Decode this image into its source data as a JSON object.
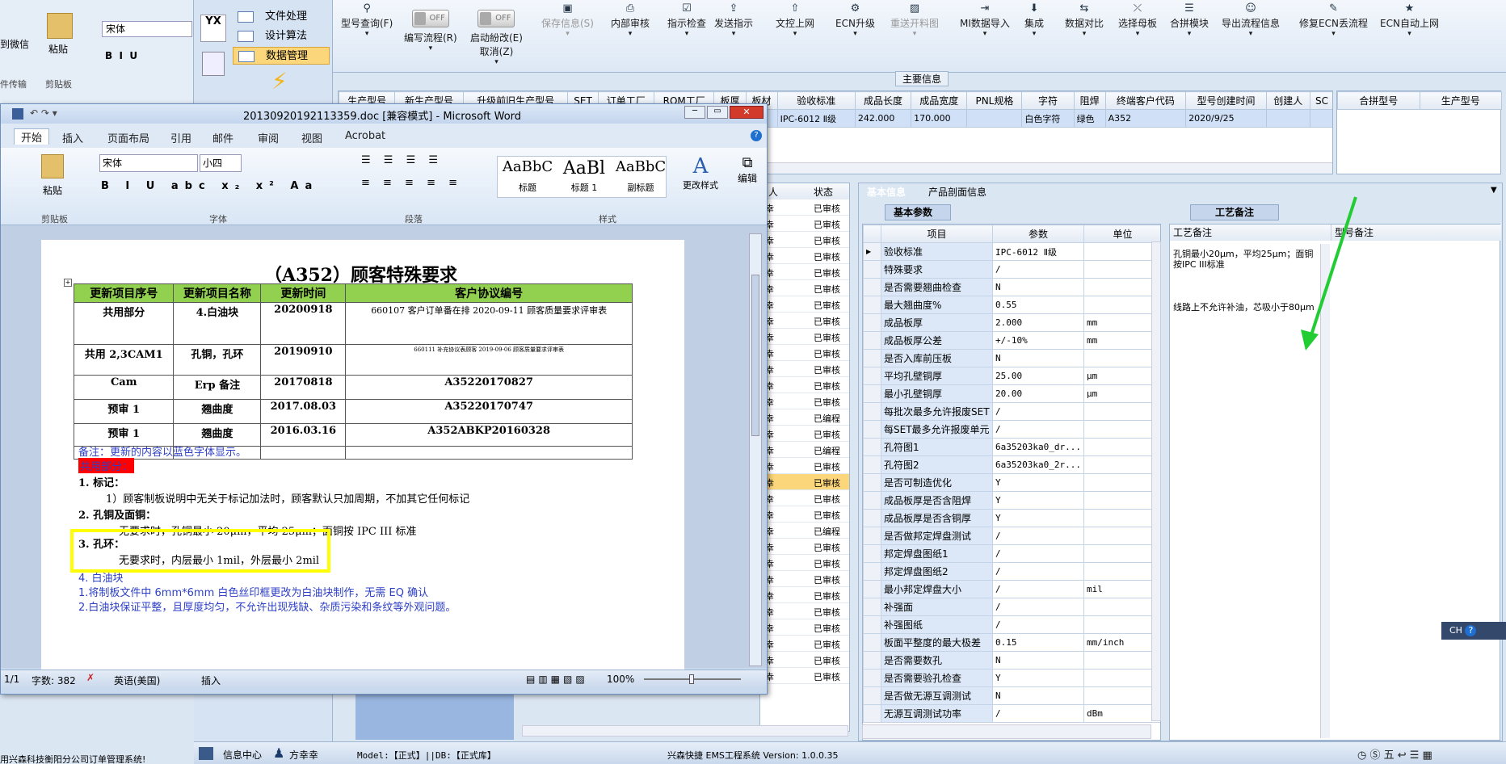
{
  "app_ribbon": {
    "buttons": [
      {
        "label": "型号查询(F)",
        "icon": "search-icon"
      },
      {
        "label": "编写流程(R)",
        "toggle": "OFF"
      },
      {
        "label": "启动紛改(E)",
        "label2": "取消(Z)",
        "toggle": "OFF"
      },
      {
        "label": "保存信息(S)",
        "icon": "save-icon",
        "disabled": true
      },
      {
        "label": "内部审核",
        "icon": "print-icon"
      },
      {
        "label": "指示检查",
        "icon": "check-icon"
      },
      {
        "label": "发送指示",
        "icon": "send-icon"
      },
      {
        "label": "文控上网",
        "icon": "upload-icon"
      },
      {
        "label": "ECN升级",
        "icon": "gear-icon"
      },
      {
        "label": "重送开料图",
        "icon": "image-icon",
        "disabled": true
      },
      {
        "label": "MI数据导入",
        "icon": "import-icon"
      },
      {
        "label": "集成",
        "icon": "download-icon"
      },
      {
        "label": "数据对比",
        "icon": "compare-icon"
      },
      {
        "label": "选择母板",
        "icon": "select-icon"
      },
      {
        "label": "合拼模块",
        "icon": "list-icon"
      },
      {
        "label": "导出流程信息",
        "icon": "smile-icon"
      },
      {
        "label": "修复ECN丢流程",
        "icon": "wrench-icon"
      },
      {
        "label": "ECN自动上网",
        "icon": "star-icon"
      }
    ],
    "main_info_title": "主要信息"
  },
  "nav": {
    "items": [
      "文件处理",
      "设计算法",
      "数据管理"
    ],
    "yx_label": "YX"
  },
  "main_grid": {
    "headers": [
      "生产型号",
      "新生产型号",
      "升级前旧生产型号",
      "SET",
      "订单工厂",
      "ROM工厂",
      "板厚",
      "板材",
      "验收标准",
      "成品长度",
      "成品宽度",
      "PNL规格",
      "字符",
      "阻焊",
      "终端客户代码",
      "型号创建时间",
      "创建人",
      "SC"
    ],
    "row": [
      "",
      "",
      "",
      "",
      "",
      "",
      "",
      "",
      "IPC-6012 Ⅱ级",
      "242.000",
      "170.000",
      "",
      "白色字符",
      "绿色",
      "A352",
      "2020/9/25",
      "",
      ""
    ],
    "right_headers": [
      "合拼型号",
      "生产型号"
    ]
  },
  "status_list": {
    "header": [
      "人",
      "状态"
    ],
    "rows": [
      "幸",
      "幸",
      "幸",
      "幸",
      "幸",
      "幸",
      "幸",
      "幸",
      "幸",
      "幸",
      "幸",
      "幸",
      "幸",
      "幸",
      "幸",
      "幸",
      "幸",
      "幸",
      "幸",
      "幸",
      "幸",
      "幸",
      "幸",
      "幸",
      "幸",
      "幸",
      "幸",
      "幸",
      "幸",
      "幸"
    ],
    "status": [
      "已审核",
      "已审核",
      "已审核",
      "已审核",
      "已审核",
      "已审核",
      "已审核",
      "已审核",
      "已审核",
      "已审核",
      "已审核",
      "已审核",
      "已审核",
      "已编程",
      "已审核",
      "已编程",
      "已审核",
      "已审核",
      "已审核",
      "已审核",
      "已编程",
      "已审核",
      "已审核",
      "已审核",
      "已审核",
      "已审核",
      "已审核",
      "已审核",
      "已审核",
      "已审核"
    ]
  },
  "detail": {
    "tabs": [
      "基本信息",
      "产品剖面信息"
    ],
    "subtab": "基本参数",
    "col_headers": [
      "项目",
      "参数",
      "单位"
    ],
    "rows": [
      [
        "验收标准",
        "IPC-6012 Ⅱ级",
        ""
      ],
      [
        "特殊要求",
        "/",
        ""
      ],
      [
        "是否需要翘曲检查",
        "N",
        ""
      ],
      [
        "最大翘曲度%",
        "0.55",
        ""
      ],
      [
        "成品板厚",
        "2.000",
        "mm"
      ],
      [
        "成品板厚公差",
        "+/-10%",
        "mm"
      ],
      [
        "是否入库前压板",
        "N",
        ""
      ],
      [
        "平均孔壁铜厚",
        "25.00",
        "μm"
      ],
      [
        "最小孔壁铜厚",
        "20.00",
        "μm"
      ],
      [
        "每批次最多允许报废SET",
        "/",
        ""
      ],
      [
        "每SET最多允许报废单元",
        "/",
        ""
      ],
      [
        "孔符图1",
        "6a35203ka0_dr...",
        ""
      ],
      [
        "孔符图2",
        "6a35203ka0_2r...",
        ""
      ],
      [
        "是否可制造优化",
        "Y",
        ""
      ],
      [
        "成品板厚是否含阻焊",
        "Y",
        ""
      ],
      [
        "成品板厚是否含铜厚",
        "Y",
        ""
      ],
      [
        "是否做邦定焊盘测试",
        "/",
        ""
      ],
      [
        "邦定焊盘图纸1",
        "/",
        ""
      ],
      [
        "邦定焊盘图纸2",
        "/",
        ""
      ],
      [
        "最小邦定焊盘大小",
        "/",
        "mil"
      ],
      [
        "补强面",
        "/",
        ""
      ],
      [
        "补强图纸",
        "/",
        ""
      ],
      [
        "板面平整度的最大极差",
        "0.15",
        "mm/inch"
      ],
      [
        "是否需要数孔",
        "N",
        ""
      ],
      [
        "是否需要验孔检查",
        "Y",
        ""
      ],
      [
        "是否做无源互调测试",
        "N",
        ""
      ],
      [
        "无源互调测试功率",
        "/",
        "dBm"
      ]
    ],
    "process_tab": "工艺备注",
    "process_headers": [
      "工艺备注",
      "型号备注"
    ],
    "process_notes": [
      "孔铜最小20μm，平均25μm；面铜按IPC III标准",
      "线路上不允许补油，芯吸小于80μm"
    ]
  },
  "word": {
    "title": "20130920192113359.doc [兼容模式] - Microsoft Word",
    "tabs": [
      "开始",
      "插入",
      "页面布局",
      "引用",
      "邮件",
      "审阅",
      "视图",
      "Acrobat"
    ],
    "font_name": "宋体",
    "font_size": "小四",
    "groups": [
      "剪贴板",
      "字体",
      "段落",
      "样式"
    ],
    "paste_label": "粘贴",
    "styles": [
      {
        "sample": "AaBbC",
        "name": "标题"
      },
      {
        "sample": "AaBl",
        "name": "标题 1"
      },
      {
        "sample": "AaBbC",
        "name": "副标题"
      }
    ],
    "change_styles": "更改样式",
    "edit": "编辑",
    "doc_title": "（A352）顾客特殊要求",
    "table_headers": [
      "更新项目序号",
      "更新项目名称",
      "更新时间",
      "客户协议编号"
    ],
    "table_rows": [
      [
        "共用部分",
        "4.白油块",
        "20200918",
        "660107 客户订单番在排 2020-09-11 顾客质量要求评审表"
      ],
      [
        "共用 2,3CAM1",
        "孔铜，孔环",
        "20190910",
        "660111 补充协议表顾客 2019-09-06 顾客质量要求评审表"
      ],
      [
        "Cam",
        "Erp 备注",
        "20170818",
        "A35220170827"
      ],
      [
        "预审 1",
        "翘曲度",
        "2017.08.03",
        "A35220170747"
      ],
      [
        "预审 1",
        "翘曲度",
        "2016.03.16",
        "A352ABKP20160328"
      ]
    ],
    "note": "备注：更新的内容以蓝色字体显示。",
    "section_common": "共用部分：",
    "s1": "1.   标记：",
    "s1_1": "1）顾客制板说明中无关于标记加法时，顾客默认只加周期，不加其它任何标记",
    "s2": "2. 孔铜及面铜：",
    "s2_1": "无要求时，孔铜最小 20μm，平均 25μm；面铜按 IPC III 标准",
    "s3": "3. 孔环：",
    "s3_1": "无要求时，内层最小 1mil，外层最小 2mil",
    "s4": "4. 白油块",
    "s4_1": "1.将制板文件中 6mm*6mm 白色丝印框更改为白油块制作，无需 EQ 确认",
    "s4_2": "2.白油块保证平整，且厚度均匀，不允许出现残缺、杂质污染和条纹等外观问题。",
    "status_page": "1/1",
    "status_words": "字数: 382",
    "status_lang": "英语(美国)",
    "status_insert": "插入",
    "zoom": "100%"
  },
  "left_back": {
    "paste": "粘贴",
    "send_wechat": "到微信",
    "transfer": "件传输",
    "clipboard": "剪贴板",
    "font": "宋体",
    "bottom_text": "用兴森科技衡阳分公司订单管理系统!"
  },
  "statusbar": {
    "info_center": "信息中心",
    "user": "方幸幸",
    "model": "Model:【正式】||DB:【正式库】",
    "version": "兴森快捷 EMS工程系统 Version: 1.0.0.35",
    "ime": "CH"
  },
  "colors": {
    "highlight": "#ffff00",
    "accent": "#3c66a8",
    "green_arrow": "#22cc33",
    "header_green": "#92d050",
    "red_label": "#ff0000"
  }
}
